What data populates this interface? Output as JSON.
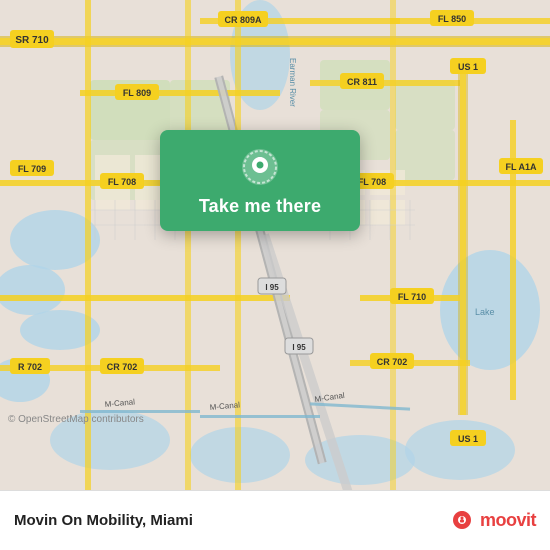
{
  "map": {
    "background_color": "#e8e0d8",
    "attribution": "© OpenStreetMap contributors"
  },
  "tooltip": {
    "button_label": "Take me there",
    "background_color": "#3daa6e"
  },
  "bottom_bar": {
    "app_title": "Movin On Mobility, Miami",
    "moovit_label": "moovit",
    "logo_pin_color": "#e84040"
  },
  "road_labels": [
    "SR 710",
    "CR 809A",
    "FL 850",
    "FL 709",
    "FL 809",
    "CR 811",
    "US 1",
    "FL 708",
    "FL 708",
    "FL A1A",
    "R 702",
    "CR 702",
    "FL 710",
    "I 95",
    "I 95",
    "CR 702",
    "US 1",
    "M-Canal",
    "M-Canal",
    "M-Canal",
    "Lake"
  ]
}
